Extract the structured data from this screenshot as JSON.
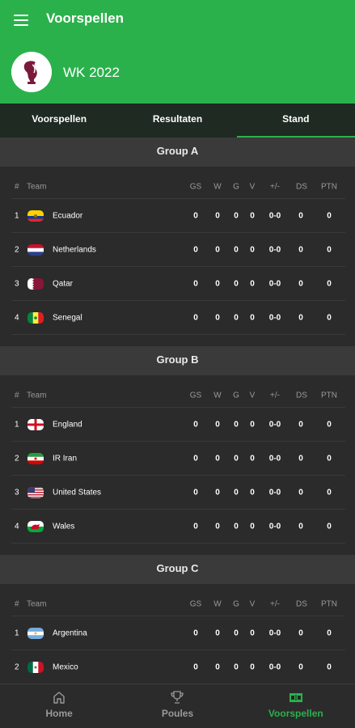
{
  "appbar": {
    "title": "Voorspellen",
    "tournament": "WK 2022"
  },
  "tabs": [
    {
      "label": "Voorspellen",
      "active": false
    },
    {
      "label": "Resultaten",
      "active": false
    },
    {
      "label": "Stand",
      "active": true
    }
  ],
  "table_headers": {
    "pos": "#",
    "team": "Team",
    "gs": "GS",
    "w": "W",
    "g": "G",
    "v": "V",
    "pm": "+/-",
    "ds": "DS",
    "ptn": "PTN"
  },
  "groups": [
    {
      "name": "Group A",
      "teams": [
        {
          "pos": "1",
          "name": "Ecuador",
          "flag": "ecuador-flag-icon",
          "gs": "0",
          "w": "0",
          "g": "0",
          "v": "0",
          "pm": "0-0",
          "ds": "0",
          "ptn": "0"
        },
        {
          "pos": "2",
          "name": "Netherlands",
          "flag": "netherlands-flag-icon",
          "gs": "0",
          "w": "0",
          "g": "0",
          "v": "0",
          "pm": "0-0",
          "ds": "0",
          "ptn": "0"
        },
        {
          "pos": "3",
          "name": "Qatar",
          "flag": "qatar-flag-icon",
          "gs": "0",
          "w": "0",
          "g": "0",
          "v": "0",
          "pm": "0-0",
          "ds": "0",
          "ptn": "0"
        },
        {
          "pos": "4",
          "name": "Senegal",
          "flag": "senegal-flag-icon",
          "gs": "0",
          "w": "0",
          "g": "0",
          "v": "0",
          "pm": "0-0",
          "ds": "0",
          "ptn": "0"
        }
      ]
    },
    {
      "name": "Group B",
      "teams": [
        {
          "pos": "1",
          "name": "England",
          "flag": "england-flag-icon",
          "gs": "0",
          "w": "0",
          "g": "0",
          "v": "0",
          "pm": "0-0",
          "ds": "0",
          "ptn": "0"
        },
        {
          "pos": "2",
          "name": "IR Iran",
          "flag": "iran-flag-icon",
          "gs": "0",
          "w": "0",
          "g": "0",
          "v": "0",
          "pm": "0-0",
          "ds": "0",
          "ptn": "0"
        },
        {
          "pos": "3",
          "name": "United States",
          "flag": "usa-flag-icon",
          "gs": "0",
          "w": "0",
          "g": "0",
          "v": "0",
          "pm": "0-0",
          "ds": "0",
          "ptn": "0"
        },
        {
          "pos": "4",
          "name": "Wales",
          "flag": "wales-flag-icon",
          "gs": "0",
          "w": "0",
          "g": "0",
          "v": "0",
          "pm": "0-0",
          "ds": "0",
          "ptn": "0"
        }
      ]
    },
    {
      "name": "Group C",
      "teams": [
        {
          "pos": "1",
          "name": "Argentina",
          "flag": "argentina-flag-icon",
          "gs": "0",
          "w": "0",
          "g": "0",
          "v": "0",
          "pm": "0-0",
          "ds": "0",
          "ptn": "0"
        },
        {
          "pos": "2",
          "name": "Mexico",
          "flag": "mexico-flag-icon",
          "gs": "0",
          "w": "0",
          "g": "0",
          "v": "0",
          "pm": "0-0",
          "ds": "0",
          "ptn": "0"
        }
      ]
    }
  ],
  "bottom_nav": [
    {
      "label": "Home",
      "icon": "home-icon",
      "active": false
    },
    {
      "label": "Poules",
      "icon": "trophy-icon",
      "active": false
    },
    {
      "label": "Voorspellen",
      "icon": "scoreboard-icon",
      "active": true
    }
  ],
  "colors": {
    "primary": "#2bb14b",
    "background": "#2b2b2b",
    "group_header": "#3a3a3a",
    "tab_bar": "#1e2a22",
    "muted": "#9a9a9a"
  }
}
